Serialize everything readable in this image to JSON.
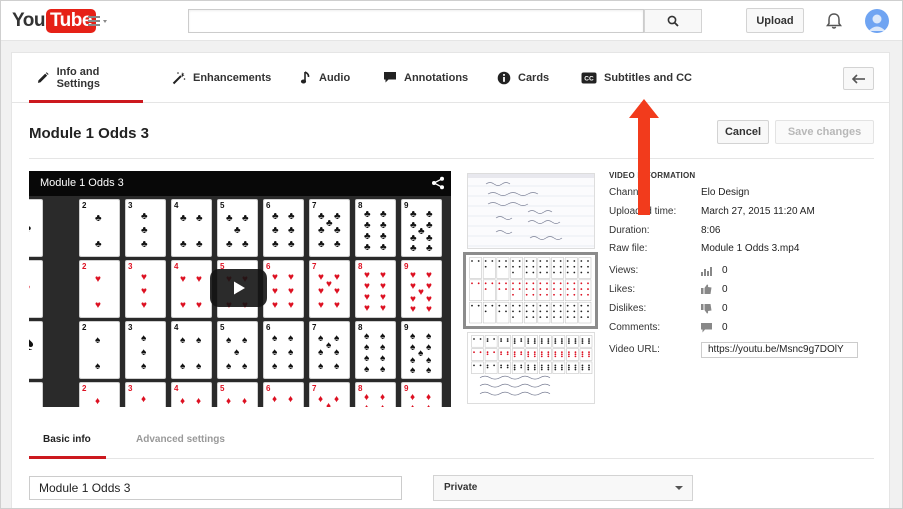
{
  "masthead": {
    "logo_you": "You",
    "logo_tube": "Tube",
    "upload_label": "Upload"
  },
  "tabs": [
    {
      "label": "Info and Settings",
      "icon": "pencil-icon",
      "active": true
    },
    {
      "label": "Enhancements",
      "icon": "magic-wand-icon",
      "active": false
    },
    {
      "label": "Audio",
      "icon": "music-note-icon",
      "active": false
    },
    {
      "label": "Annotations",
      "icon": "speech-bubble-icon",
      "active": false
    },
    {
      "label": "Cards",
      "icon": "info-icon",
      "active": false
    },
    {
      "label": "Subtitles and CC",
      "icon": "cc-icon",
      "active": false
    }
  ],
  "page": {
    "title": "Module 1 Odds 3",
    "cancel_label": "Cancel",
    "save_label": "Save changes"
  },
  "player": {
    "title": "Module 1 Odds 3"
  },
  "video_info": {
    "heading": "VIDEO INFORMATION",
    "channel_label": "Channel:",
    "channel_value": "Elo Design",
    "uploaded_label": "Uploaded time:",
    "uploaded_value": "March 27, 2015 11:20 AM",
    "duration_label": "Duration:",
    "duration_value": "8:06",
    "raw_file_label": "Raw file:",
    "raw_file_value": "Module 1 Odds 3.mp4",
    "views_label": "Views:",
    "views_value": "0",
    "likes_label": "Likes:",
    "likes_value": "0",
    "dislikes_label": "Dislikes:",
    "dislikes_value": "0",
    "comments_label": "Comments:",
    "comments_value": "0",
    "url_label": "Video URL:",
    "url_value": "https://youtu.be/Msnc9g7DOlY"
  },
  "basic": {
    "tab_basic": "Basic info",
    "tab_advanced": "Advanced settings",
    "title_value": "Module 1 Odds 3",
    "privacy_value": "Private"
  },
  "colors": {
    "accent_red": "#cc181e",
    "annotation_arrow": "#f23b1c",
    "logo_red": "#e62117"
  }
}
